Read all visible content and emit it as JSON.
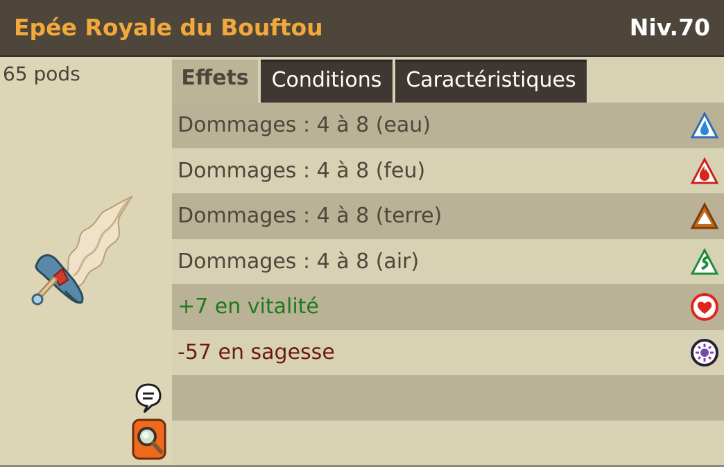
{
  "header": {
    "title": "Epée Royale du Bouftou",
    "level": "Niv.70"
  },
  "item": {
    "weight": "65 pods",
    "image_icon": "sword-icon"
  },
  "tabs": [
    {
      "label": "Effets",
      "active": true
    },
    {
      "label": "Conditions",
      "active": false
    },
    {
      "label": "Caractéristiques",
      "active": false
    }
  ],
  "effects": [
    {
      "text": "Dommages : 4 à 8 (eau)",
      "icon": "water-icon",
      "color": "#4f463b"
    },
    {
      "text": "Dommages : 4 à 8 (feu)",
      "icon": "fire-icon",
      "color": "#4f463b"
    },
    {
      "text": "Dommages : 4 à 8 (terre)",
      "icon": "earth-icon",
      "color": "#4f463b"
    },
    {
      "text": "Dommages : 4 à 8 (air)",
      "icon": "air-icon",
      "color": "#4f463b"
    },
    {
      "text": "+7 en vitalité",
      "icon": "vitality-heart-icon",
      "color": "#1d7a1d"
    },
    {
      "text": "-57 en sagesse",
      "icon": "wisdom-icon",
      "color": "#6d1a0e"
    }
  ],
  "colors": {
    "header_bg": "#4f463b",
    "title": "#f2a93b",
    "panel_bg": "#d8d2b4",
    "row_dark": "#bab296"
  }
}
